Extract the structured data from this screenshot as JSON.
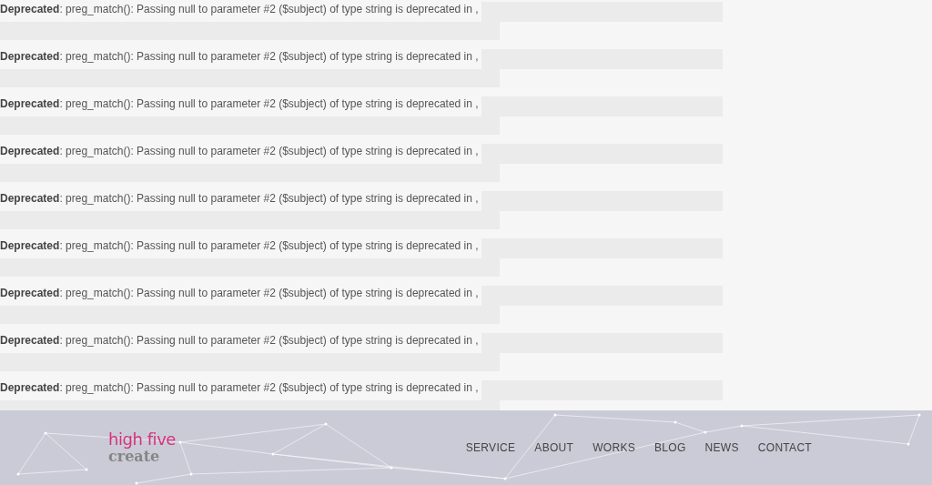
{
  "warnings": [
    {
      "label": "Deprecated",
      "message": ": preg_match(): Passing null to parameter #2 ($subject) of type string is deprecated in ,"
    },
    {
      "label": "Deprecated",
      "message": ": preg_match(): Passing null to parameter #2 ($subject) of type string is deprecated in ,"
    },
    {
      "label": "Deprecated",
      "message": ": preg_match(): Passing null to parameter #2 ($subject) of type string is deprecated in ,"
    },
    {
      "label": "Deprecated",
      "message": ": preg_match(): Passing null to parameter #2 ($subject) of type string is deprecated in ,"
    },
    {
      "label": "Deprecated",
      "message": ": preg_match(): Passing null to parameter #2 ($subject) of type string is deprecated in ,"
    },
    {
      "label": "Deprecated",
      "message": ": preg_match(): Passing null to parameter #2 ($subject) of type string is deprecated in ,"
    },
    {
      "label": "Deprecated",
      "message": ": preg_match(): Passing null to parameter #2 ($subject) of type string is deprecated in ,"
    },
    {
      "label": "Deprecated",
      "message": ": preg_match(): Passing null to parameter #2 ($subject) of type string is deprecated in ,"
    },
    {
      "label": "Deprecated",
      "message": ": preg_match(): Passing null to parameter #2 ($subject) of type string is deprecated in ,"
    }
  ],
  "footer": {
    "logo": {
      "line1": "high five",
      "line2": "create"
    },
    "nav": [
      "SERVICE",
      "ABOUT",
      "WORKS",
      "BLOG",
      "NEWS",
      "CONTACT"
    ]
  }
}
